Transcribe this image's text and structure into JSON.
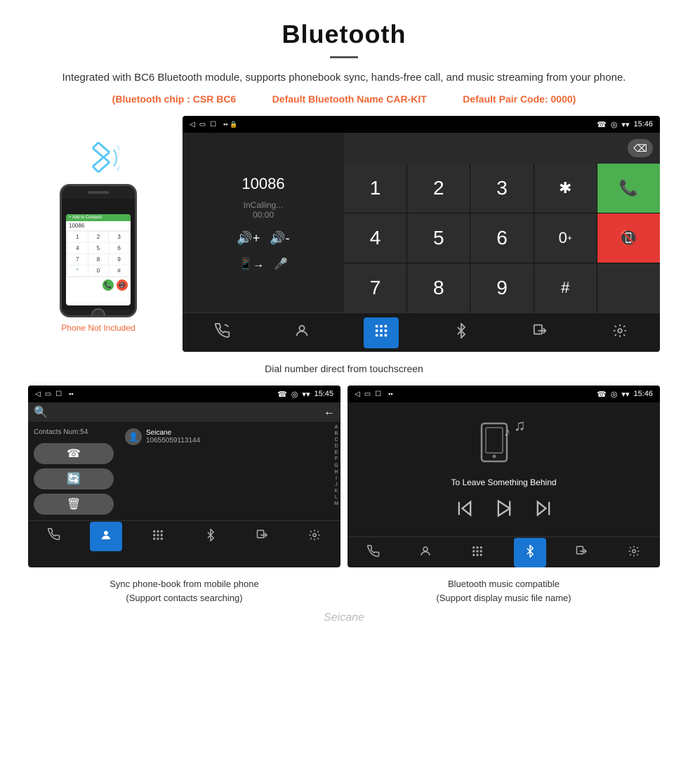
{
  "header": {
    "title": "Bluetooth",
    "description": "Integrated with BC6 Bluetooth module, supports phonebook sync, hands-free call, and music streaming from your phone.",
    "specs": {
      "chip": "(Bluetooth chip : CSR BC6",
      "name": "Default Bluetooth Name CAR-KIT",
      "code": "Default Pair Code: 0000)"
    }
  },
  "main_screen": {
    "status_bar": {
      "left_icons": "◁  ▭  ☐",
      "right_icons": "☎  ◎  ▾",
      "time": "15:46"
    },
    "dialer": {
      "number": "10086",
      "status": "InCalling...",
      "timer": "00:00",
      "keys": [
        "1",
        "2",
        "3",
        "*",
        "4",
        "5",
        "6",
        "0+",
        "7",
        "8",
        "9",
        "#"
      ]
    },
    "nav_items": [
      "☎+",
      "👤",
      "⠿",
      "⚹",
      "⧉",
      "⚙"
    ]
  },
  "dial_caption": "Dial number direct from touchscreen",
  "phonebook_screen": {
    "contacts_num": "Contacts Num:54",
    "contact": {
      "name": "Seicane",
      "number": "10655059113144"
    },
    "alpha": [
      "A",
      "B",
      "C",
      "D",
      "E",
      "F",
      "G",
      "H",
      "I",
      "J",
      "K",
      "L",
      "M"
    ]
  },
  "music_screen": {
    "song_title": "To Leave Something Behind",
    "status_bar_time": "15:46"
  },
  "bottom_captions": {
    "phonebook": "Sync phone-book from mobile phone\n(Support contacts searching)",
    "music": "Bluetooth music compatible\n(Support display music file name)"
  },
  "phone_label": "Phone Not Included",
  "watermark": "Seicane"
}
